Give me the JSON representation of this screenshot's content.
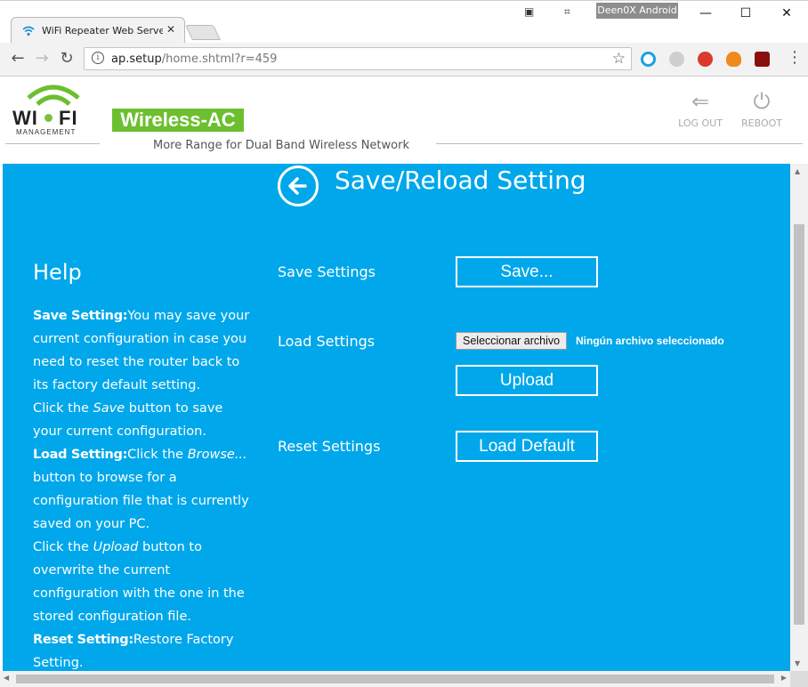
{
  "browser": {
    "tab_title": "WiFi Repeater Web Serve",
    "tab_close": "✕",
    "profile_name": "Deen0X Android",
    "url_host": "ap.setup",
    "url_path": "/home.shtml?r=459",
    "window_controls": {
      "minimize": "—",
      "maximize": "☐",
      "close": "✕"
    }
  },
  "header": {
    "logo_wi": "WI",
    "logo_fi": "FI",
    "logo_sub": "MANAGEMENT",
    "brand": "Wireless-AC",
    "tagline": "More Range for Dual Band Wireless Network",
    "logout_label": "LOG OUT",
    "reboot_label": "REBOOT"
  },
  "page": {
    "title": "Save/Reload Setting",
    "help": {
      "heading": "Help",
      "save_key": "Save Setting:",
      "save_text": "You may save your current configuration in case you need to reset the router back to its factory default setting.",
      "click_the": "Click the ",
      "save_word": "Save",
      "save_text2": " button to save your current configuration.",
      "load_key": "Load Setting:",
      "load_text_pre": "Click the ",
      "browse_word": "Browse...",
      "load_text": " button to browse for a configuration file that is currently saved on your PC.",
      "click_the2": "Click the ",
      "upload_word": "Upload",
      "upload_text": " button to overwrite the current configuration with the one in the stored configuration file.",
      "reset_key": "Reset Setting:",
      "reset_text": "Restore Factory Setting."
    },
    "save_settings_label": "Save Settings",
    "save_button": "Save...",
    "load_settings_label": "Load Settings",
    "file_button": "Seleccionar archivo",
    "file_status": "Ningún archivo seleccionado",
    "upload_button": "Upload",
    "reset_settings_label": "Reset Settings",
    "load_default_button": "Load Default"
  },
  "colors": {
    "content_bg": "#00a7ea",
    "brand_green": "#6cbf2e"
  }
}
